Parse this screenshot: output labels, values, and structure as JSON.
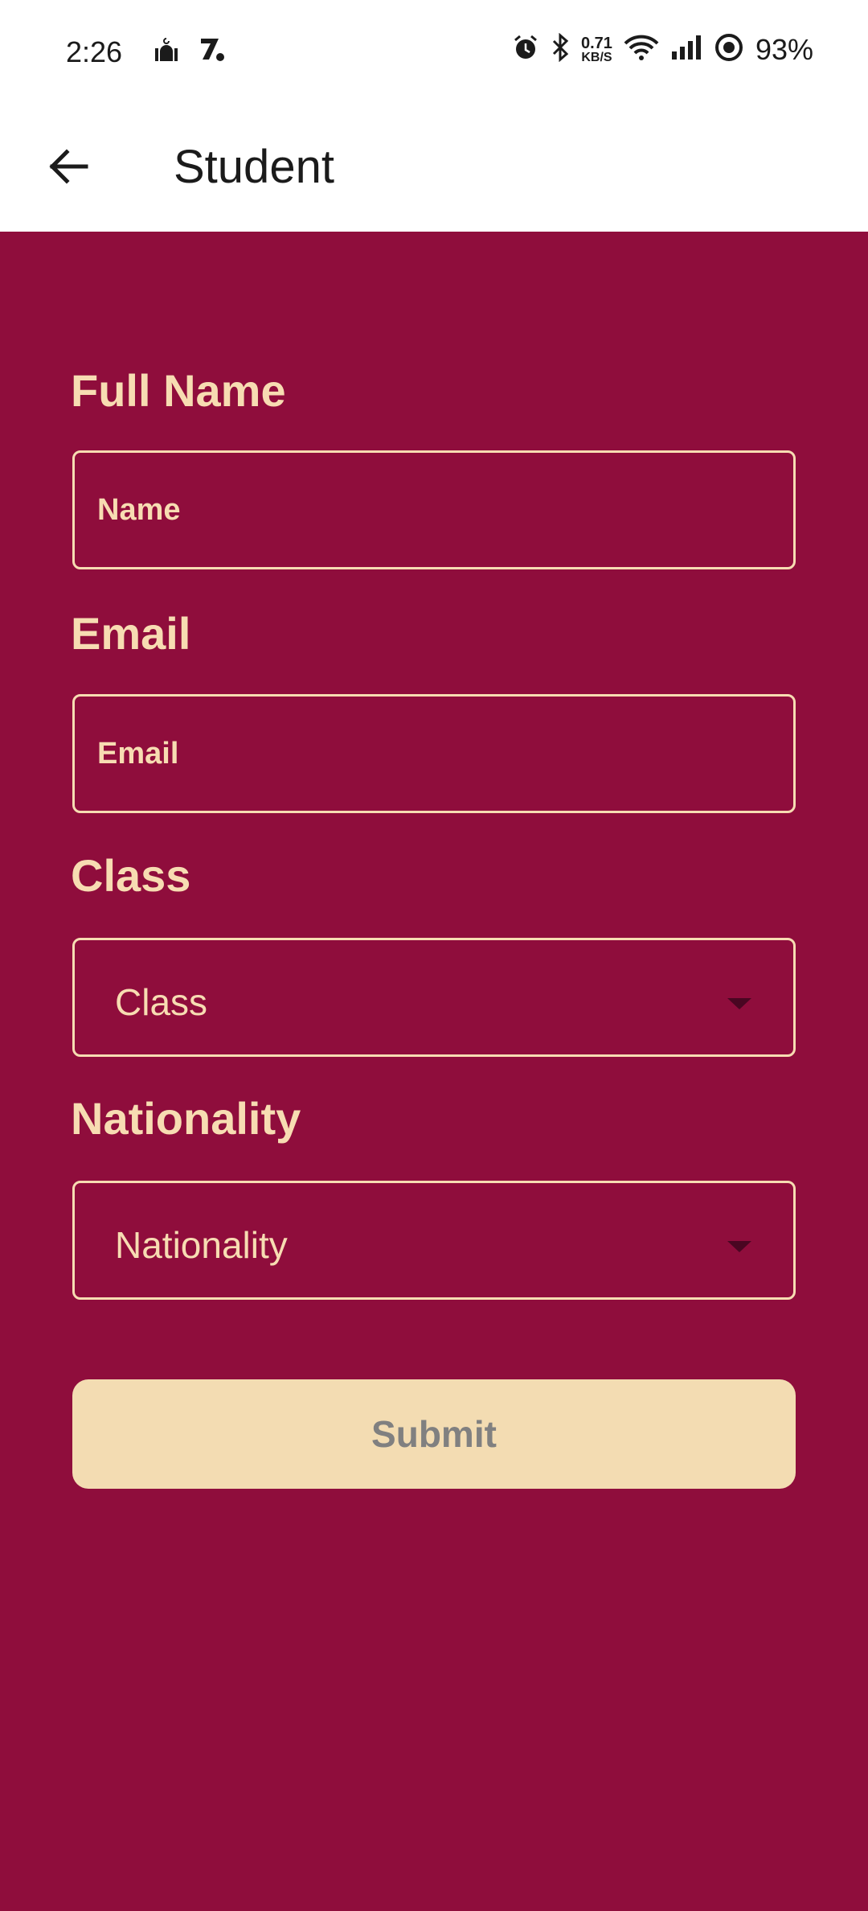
{
  "status_bar": {
    "time": "2:26",
    "network_speed_value": "0.71",
    "network_speed_unit": "KB/S",
    "battery": "93%",
    "icons": [
      "mosque-icon",
      "app-z-icon",
      "alarm-icon",
      "bluetooth-icon",
      "wifi-icon",
      "signal-icon",
      "data-saver-icon"
    ]
  },
  "app_bar": {
    "title": "Student",
    "back_icon": "arrow-left-icon"
  },
  "form": {
    "full_name": {
      "label": "Full Name",
      "placeholder": "Name",
      "value": ""
    },
    "email": {
      "label": "Email",
      "placeholder": "Email",
      "value": ""
    },
    "class": {
      "label": "Class",
      "selected": "Class"
    },
    "nationality": {
      "label": "Nationality",
      "selected": "Nationality"
    },
    "submit_label": "Submit"
  },
  "colors": {
    "background": "#8f0d3c",
    "accent": "#f7dcb2",
    "button_bg": "#f3dcb2",
    "button_text": "#808080"
  }
}
